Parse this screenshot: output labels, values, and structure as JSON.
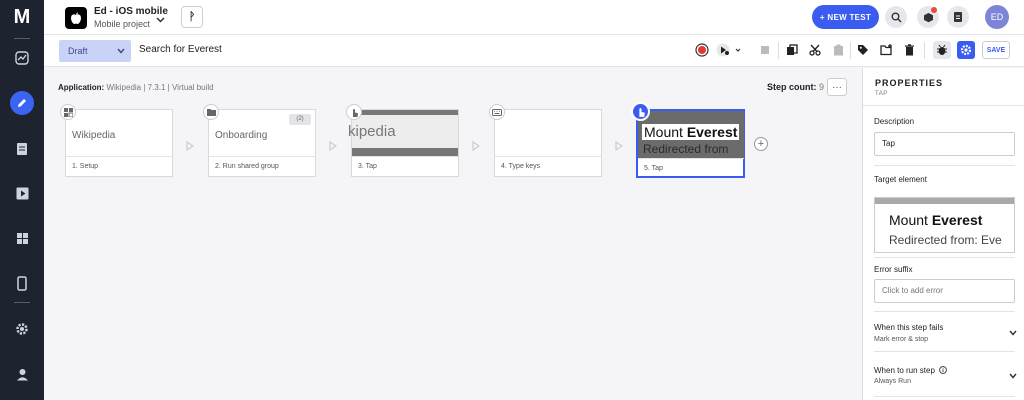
{
  "app": {
    "logo_text": "M",
    "project_title": "Ed - iOS mobile",
    "project_subtitle": "Mobile project",
    "branch_symbol": "ᚹ",
    "new_test_label": "+ NEW TEST",
    "user_initials": "ED",
    "accent_color": "#3b5cf0"
  },
  "toolbar": {
    "status_label": "Draft",
    "test_name": "Search for Everest",
    "save_label": "SAVE"
  },
  "canvas": {
    "application_label": "Application:",
    "application_value": "Wikipedia | 7.3.1 | Virtual build",
    "step_count_label": "Step count:",
    "step_count_value": "9",
    "more_label": "···",
    "add_step_label": "+"
  },
  "steps": [
    {
      "thumb_text": "Wikipedia",
      "label": "1. Setup",
      "icon": "grid-icon"
    },
    {
      "thumb_text": "Onboarding",
      "label": "2. Run shared group",
      "icon": "folder-icon",
      "badge": "(2)"
    },
    {
      "thumb_text": "kipedia",
      "label": "3. Tap",
      "icon": "tap-icon"
    },
    {
      "thumb_text": "",
      "label": "4. Type keys",
      "icon": "keyboard-icon"
    },
    {
      "thumb_text_prefix": "Mount ",
      "thumb_text_bold": "Everest",
      "thumb_text_line2": "Redirected from",
      "label": "5. Tap",
      "icon": "tap-icon"
    }
  ],
  "properties": {
    "title": "PROPERTIES",
    "subtitle": "TAP",
    "description_label": "Description",
    "description_value": "Tap",
    "target_label": "Target element",
    "target_line1_prefix": "Mount ",
    "target_line1_bold": "Everest",
    "target_line2": "Redirected from: Eve",
    "error_suffix_label": "Error suffix",
    "error_suffix_placeholder": "Click to add error",
    "fail_label": "When this step fails",
    "fail_value": "Mark error & stop",
    "run_label": "When to run step",
    "run_value": "Always Run"
  }
}
